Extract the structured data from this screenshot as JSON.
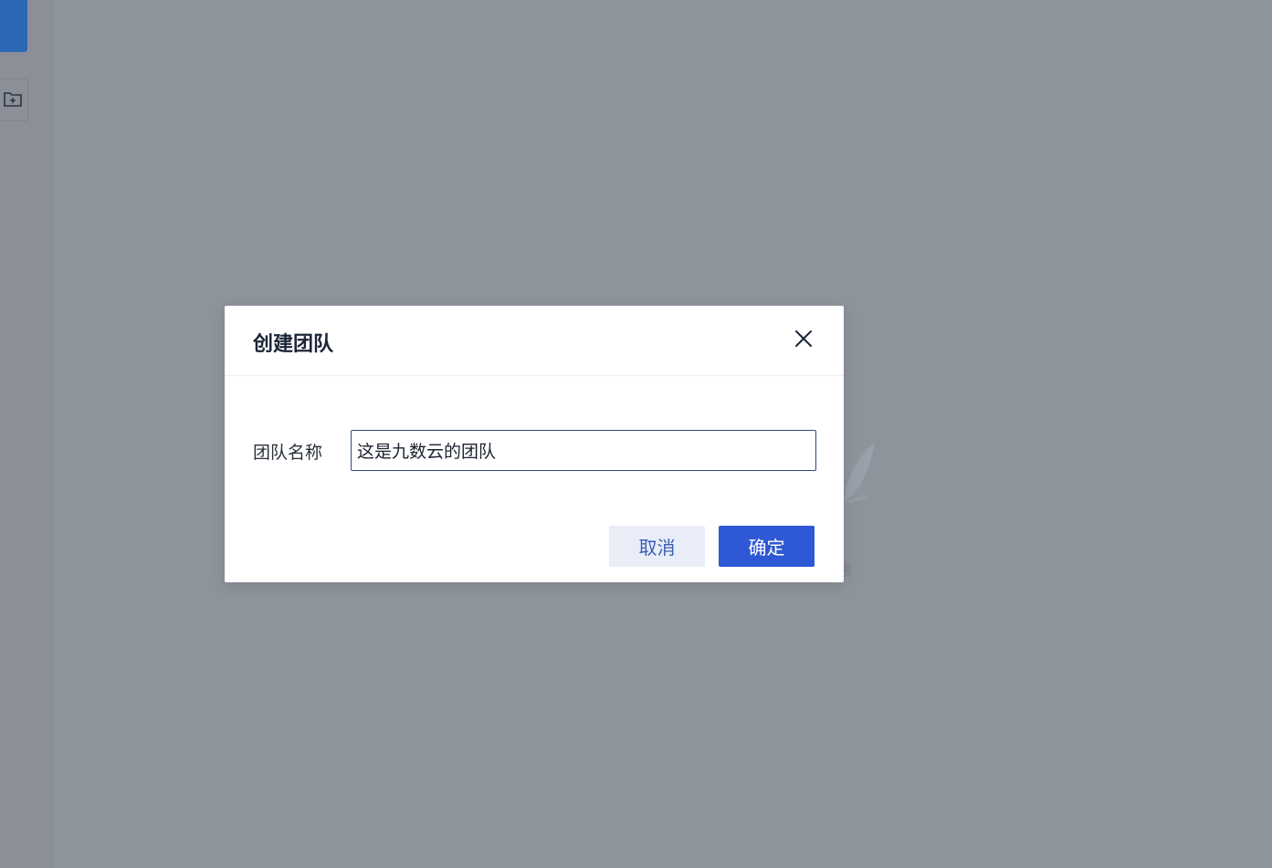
{
  "background": {
    "empty_text": "表"
  },
  "dialog": {
    "title": "创建团队",
    "field_label": "团队名称",
    "field_value": "这是九数云的团队",
    "cancel_label": "取消",
    "confirm_label": "确定"
  },
  "colors": {
    "overlay": "#8e949c",
    "primary": "#2e58d6",
    "cancel_bg": "#e8edf8",
    "sidebar_active": "#2c68b4"
  },
  "icons": {
    "close": "close-icon",
    "folder_add": "folder-add-icon"
  }
}
